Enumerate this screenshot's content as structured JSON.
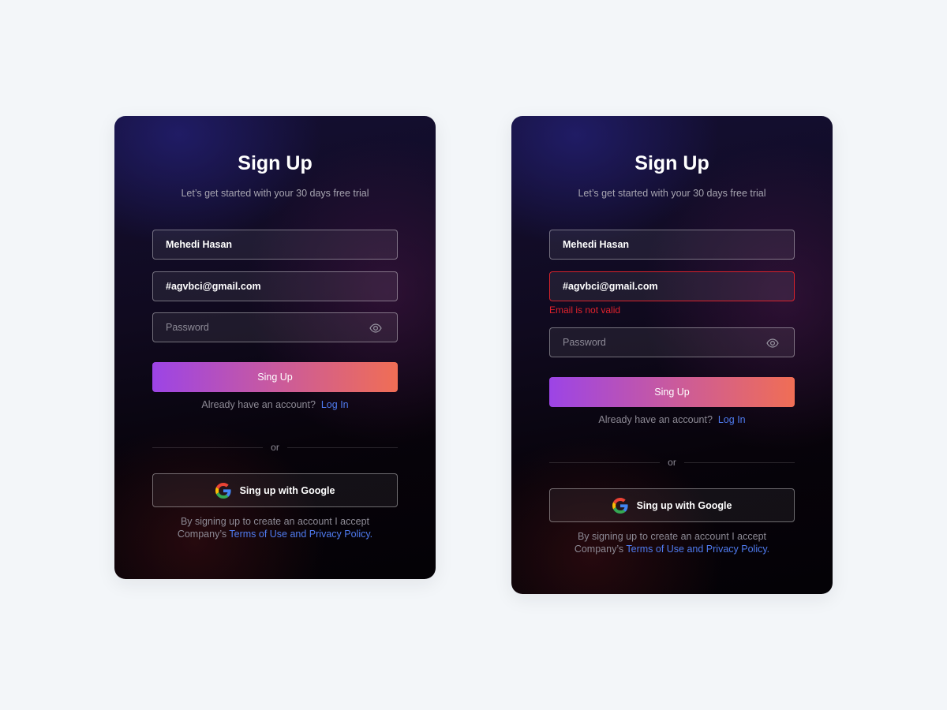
{
  "colors": {
    "page_background": "#f3f6f9",
    "card_background": "#0a0614",
    "accent_gradient_start": "#9c44e6",
    "accent_gradient_end": "#f06e55",
    "link": "#4f7bf0",
    "error": "#e0222c"
  },
  "cards": [
    {
      "title": "Sign Up",
      "subtitle": "Let’s get started with your 30 days free trial",
      "name_value": "Mehedi Hasan",
      "email_value": "#agvbci@gmail.com",
      "email_error": "",
      "password_placeholder": "Password",
      "password_icon": "eye-icon",
      "submit_label": "Sing Up",
      "account_prompt": "Already have an account?",
      "login_link": "Log In",
      "divider_text": "or",
      "google_label": "Sing up with Google",
      "google_icon": "google-logo-icon",
      "terms_line1": "By signing up to create an account I accept",
      "terms_prefix": "Company’s ",
      "terms_link": "Terms of Use and Privacy Policy."
    },
    {
      "title": "Sign Up",
      "subtitle": "Let’s get started with your 30 days free trial",
      "name_value": "Mehedi Hasan",
      "email_value": "#agvbci@gmail.com",
      "email_error": "Email is not valid",
      "password_placeholder": "Password",
      "password_icon": "eye-icon",
      "submit_label": "Sing Up",
      "account_prompt": "Already have an account?",
      "login_link": "Log In",
      "divider_text": "or",
      "google_label": "Sing up with Google",
      "google_icon": "google-logo-icon",
      "terms_line1": "By signing up to create an account I accept",
      "terms_prefix": "Company’s ",
      "terms_link": "Terms of Use and Privacy Policy."
    }
  ]
}
